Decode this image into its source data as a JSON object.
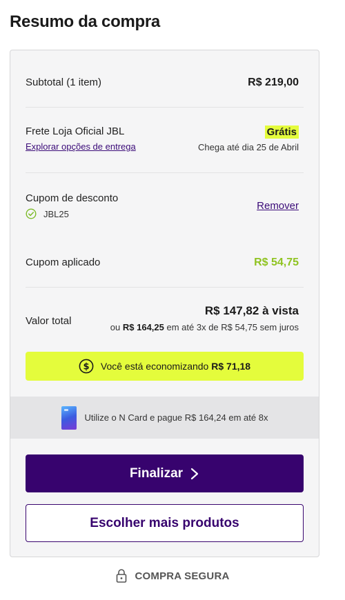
{
  "page": {
    "title": "Resumo da compra"
  },
  "summary": {
    "subtotal_label": "Subtotal (1 item)",
    "subtotal_value": "R$ 219,00",
    "shipping_label": "Frete Loja Oficial JBL",
    "shipping_link": "Explorar opções de entrega",
    "shipping_value": "Grátis",
    "shipping_eta": "Chega até dia 25 de Abril",
    "coupon_label": "Cupom de desconto",
    "coupon_code": "JBL25",
    "coupon_remove": "Remover",
    "coupon_applied_label": "Cupom aplicado",
    "coupon_applied_value": "R$ 54,75",
    "total_label": "Valor total",
    "total_main": "R$ 147,82 à vista",
    "total_or": "ou",
    "total_installment_amount": "R$ 164,25",
    "total_installment_rest": "em até 3x de R$ 54,75 sem juros"
  },
  "savings": {
    "text": "Você está economizando",
    "amount": "R$ 71,18"
  },
  "ncard": {
    "text": "Utilize o N Card e pague R$ 164,24 em até 8x"
  },
  "actions": {
    "finalize_label": "Finalizar",
    "more_products_label": "Escolher mais produtos"
  },
  "footer": {
    "secure_label": "COMPRA SEGURA"
  },
  "colors": {
    "brand_purple": "#37036e",
    "highlight_lime": "#e4fc3c",
    "discount_green": "#8fc320"
  },
  "icons": [
    "check-circle-icon",
    "dollar-circle-icon",
    "ncard-icon",
    "chevron-right-icon",
    "lock-icon"
  ]
}
